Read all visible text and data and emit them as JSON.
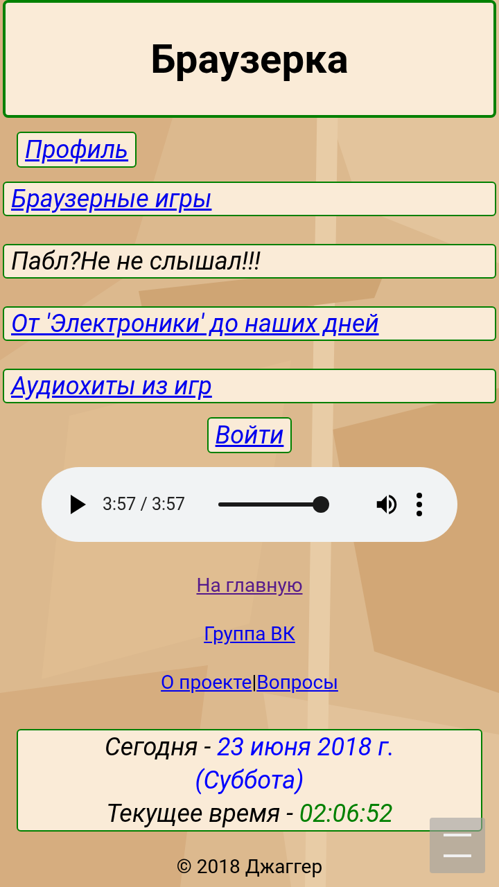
{
  "header": {
    "title": "Браузерка"
  },
  "profile_link": {
    "label": "Профиль"
  },
  "menu": [
    {
      "kind": "link",
      "label": "Браузерные игры"
    },
    {
      "kind": "text",
      "label": "Пабл?Не не слышал!!!"
    },
    {
      "kind": "link",
      "label": "От 'Электроники' до наших дней"
    },
    {
      "kind": "link",
      "label": "Аудиохиты из игр"
    }
  ],
  "login_link": {
    "label": "Войти"
  },
  "audio_player": {
    "time": "3:57 / 3:57",
    "level": 1
  },
  "footer_links": [
    {
      "items": [
        {
          "label": "На главную",
          "visited": true
        }
      ]
    },
    {
      "items": [
        {
          "label": "Группа ВК",
          "visited": false
        }
      ]
    },
    {
      "items": [
        {
          "label": "О проекте",
          "visited": false
        },
        {
          "label": "Вопросы",
          "visited": false
        }
      ],
      "separator": "|"
    }
  ],
  "date_box": {
    "date_label": "Сегодня - ",
    "date": "23 июня 2018 г.",
    "weekday": "(Суббота)",
    "time_label": "Текущее время - ",
    "time": "02:06:52"
  },
  "copyright": "© 2018 Джаггер"
}
